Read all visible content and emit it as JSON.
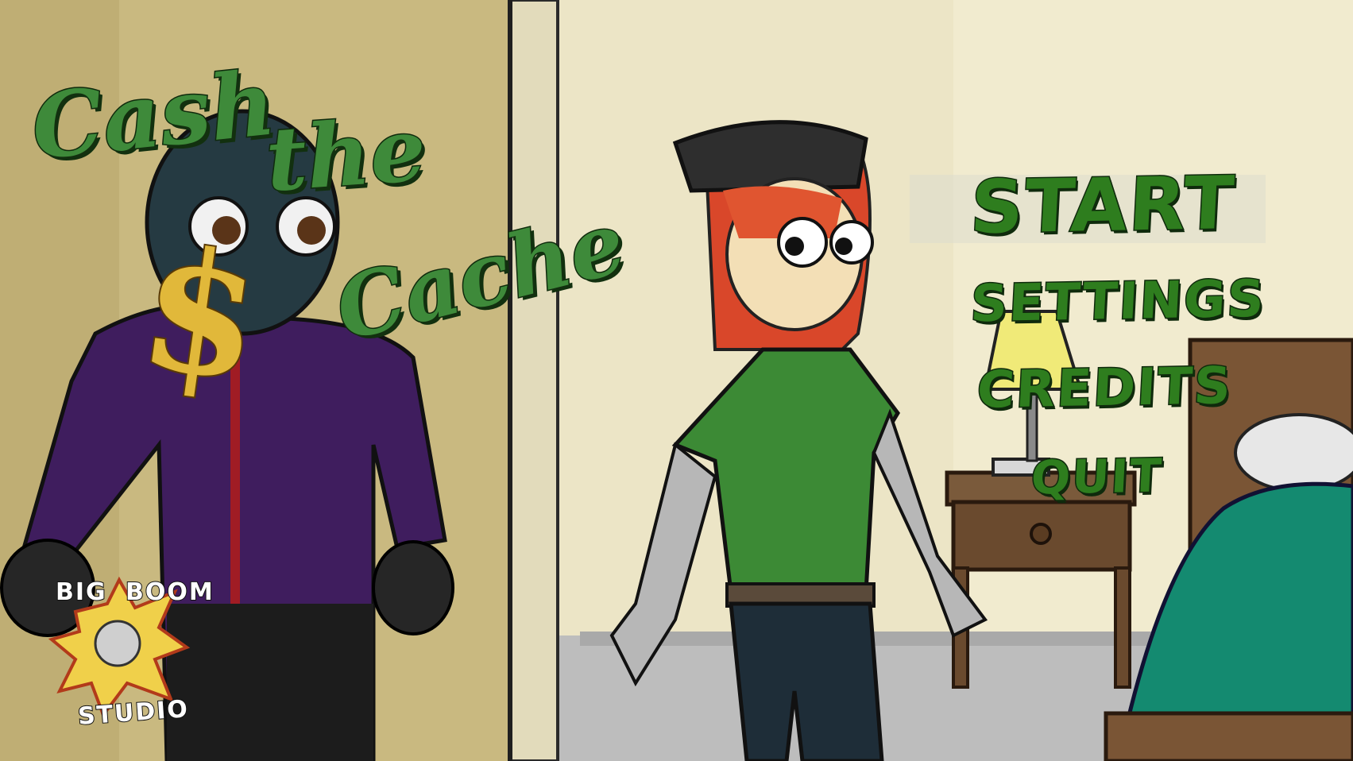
{
  "game": {
    "title_line1": "Cash",
    "title_line2": "the",
    "title_line3": "Cache",
    "title_symbol": "$"
  },
  "menu": {
    "items": [
      {
        "id": "start",
        "label": "START",
        "highlighted": true
      },
      {
        "id": "settings",
        "label": "SETTINGS"
      },
      {
        "id": "credits",
        "label": "CREDITS"
      },
      {
        "id": "quit",
        "label": "QUIT"
      }
    ]
  },
  "studio": {
    "word1": "BIG",
    "word2": "BOOM",
    "word3": "STUDIO"
  },
  "colors": {
    "menu_green": "#2e7d1e",
    "menu_outline": "#0f2a0c",
    "title_green": "#3e8a3a",
    "wall": "#ece5c6",
    "door": "#c9b980",
    "hoodie": "#3f1d5e",
    "shirt": "#3c8a35",
    "hair": "#e05530",
    "bed": "#148a70"
  }
}
